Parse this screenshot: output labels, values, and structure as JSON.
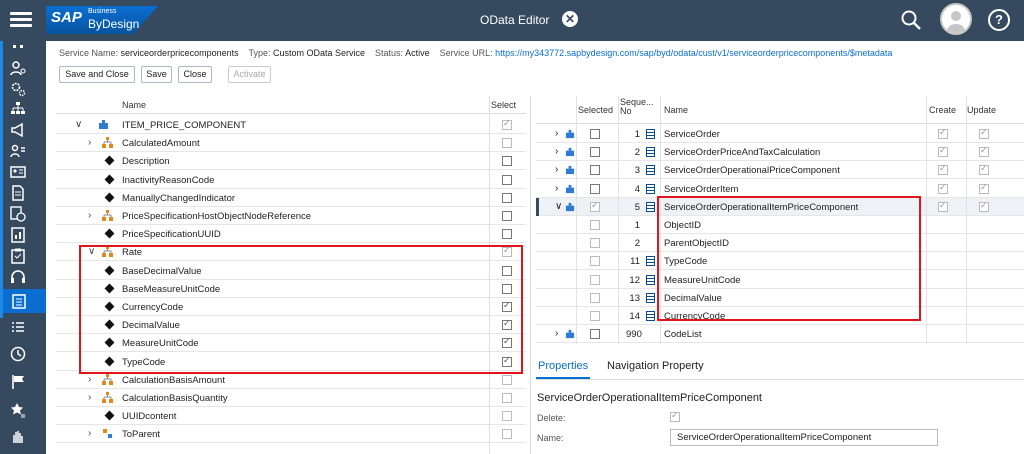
{
  "shell": {
    "logo_main": "SAP",
    "logo_super": "Business",
    "logo_product": "ByDesign",
    "title": "OData Editor"
  },
  "header": {
    "service_name_label": "Service Name:",
    "service_name": "serviceorderpricecomponents",
    "type_label": "Type:",
    "type": "Custom OData Service",
    "status_label": "Status:",
    "status": "Active",
    "url_label": "Service URL:",
    "url": "https://my343772.sapbydesign.com/sap/byd/odata/cust/v1/serviceorderpricecomponents/$metadata",
    "buttons": {
      "save_close": "Save and Close",
      "save": "Save",
      "close": "Close",
      "activate": "Activate"
    }
  },
  "left_table": {
    "col_name": "Name",
    "col_select": "Select",
    "rows": [
      {
        "name": "ITEM_PRICE_COMPONENT",
        "checked": true
      },
      {
        "name": "CalculatedAmount",
        "checked": false
      },
      {
        "name": "Description",
        "checked": false
      },
      {
        "name": "InactivityReasonCode",
        "checked": false
      },
      {
        "name": "ManuallyChangedIndicator",
        "checked": false
      },
      {
        "name": "PriceSpecificationHostObjectNodeReference",
        "checked": false
      },
      {
        "name": "PriceSpecificationUUID",
        "checked": false
      },
      {
        "name": "Rate",
        "checked": true
      },
      {
        "name": "BaseDecimalValue",
        "checked": false
      },
      {
        "name": "BaseMeasureUnitCode",
        "checked": false
      },
      {
        "name": "CurrencyCode",
        "checked": true
      },
      {
        "name": "DecimalValue",
        "checked": true
      },
      {
        "name": "MeasureUnitCode",
        "checked": true
      },
      {
        "name": "TypeCode",
        "checked": true
      },
      {
        "name": "CalculationBasisAmount",
        "checked": false
      },
      {
        "name": "CalculationBasisQuantity",
        "checked": false
      },
      {
        "name": "UUIDcontent",
        "checked": false
      },
      {
        "name": "ToParent",
        "checked": false
      }
    ]
  },
  "right_table": {
    "col_selected": "Selected",
    "col_seq": "Seque... No",
    "col_name": "Name",
    "col_create": "Create",
    "col_update": "Update",
    "rows": [
      {
        "seq": "1",
        "name": "ServiceOrder"
      },
      {
        "seq": "2",
        "name": "ServiceOrderPriceAndTaxCalculation"
      },
      {
        "seq": "3",
        "name": "ServiceOrderOperationalPriceComponent"
      },
      {
        "seq": "4",
        "name": "ServiceOrderItem"
      },
      {
        "seq": "5",
        "name": "ServiceOrderOperationalItemPriceComponent"
      },
      {
        "seq": "1",
        "name": "ObjectID"
      },
      {
        "seq": "2",
        "name": "ParentObjectID"
      },
      {
        "seq": "11",
        "name": "TypeCode"
      },
      {
        "seq": "12",
        "name": "MeasureUnitCode"
      },
      {
        "seq": "13",
        "name": "DecimalValue"
      },
      {
        "seq": "14",
        "name": "CurrencyCode"
      },
      {
        "seq": "990",
        "name": "CodeList"
      }
    ]
  },
  "tabs": {
    "properties": "Properties",
    "navigation": "Navigation Property"
  },
  "properties": {
    "title": "ServiceOrderOperationalItemPriceComponent",
    "delete_label": "Delete:",
    "name_label": "Name:",
    "name_value": "ServiceOrderOperationalItemPriceComponent"
  },
  "colors": {
    "shell": "#354a5f",
    "accent": "#0a6ed1",
    "highlight": "#e0161c"
  }
}
